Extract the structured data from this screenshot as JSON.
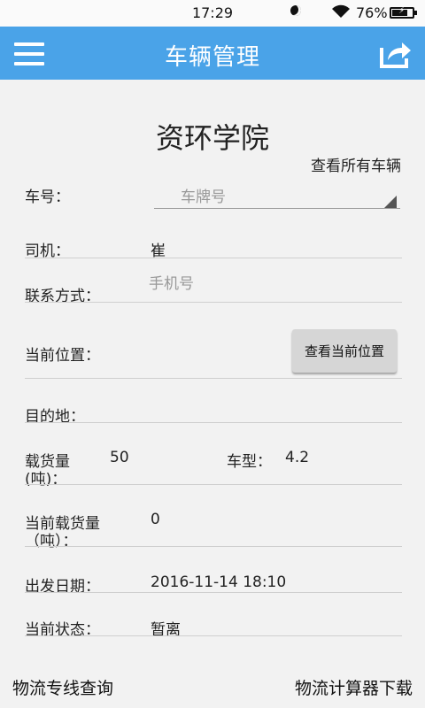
{
  "status_bar": {
    "time": "17:29",
    "battery_percent_text": "76%",
    "battery_level": 0.76,
    "icons": [
      "moon-icon",
      "wifi-icon",
      "battery-charging-icon"
    ]
  },
  "app_bar": {
    "title": "车辆管理",
    "background": "#4aa3e8",
    "icons": [
      "menu-icon",
      "share-icon"
    ]
  },
  "school": "资环学院",
  "view_all_vehicles": "查看所有车辆",
  "form": {
    "plate": {
      "label": "车号：",
      "placeholder": "车牌号"
    },
    "driver": {
      "label": "司机：",
      "value": "崔"
    },
    "contact": {
      "label": "联系方式：",
      "placeholder": "手机号"
    },
    "location": {
      "label": "当前位置：",
      "button": "查看当前位置"
    },
    "destination": {
      "label": "目的地："
    },
    "capacity": {
      "label_line1": "载货量",
      "label_line2": "(吨)：",
      "value": "50"
    },
    "vehicle_type": {
      "label": "车型：",
      "value": "4.2"
    },
    "current_load": {
      "label_line1": "当前载货量",
      "label_line2": "（吨）：",
      "value": "0"
    },
    "departure": {
      "label": "出发日期：",
      "value": "2016-11-14 18:10"
    },
    "status": {
      "label": "当前状态：",
      "value": "暂离"
    }
  },
  "bottom": {
    "left_link": "物流专线查询",
    "right_link": "物流计算器下载"
  }
}
